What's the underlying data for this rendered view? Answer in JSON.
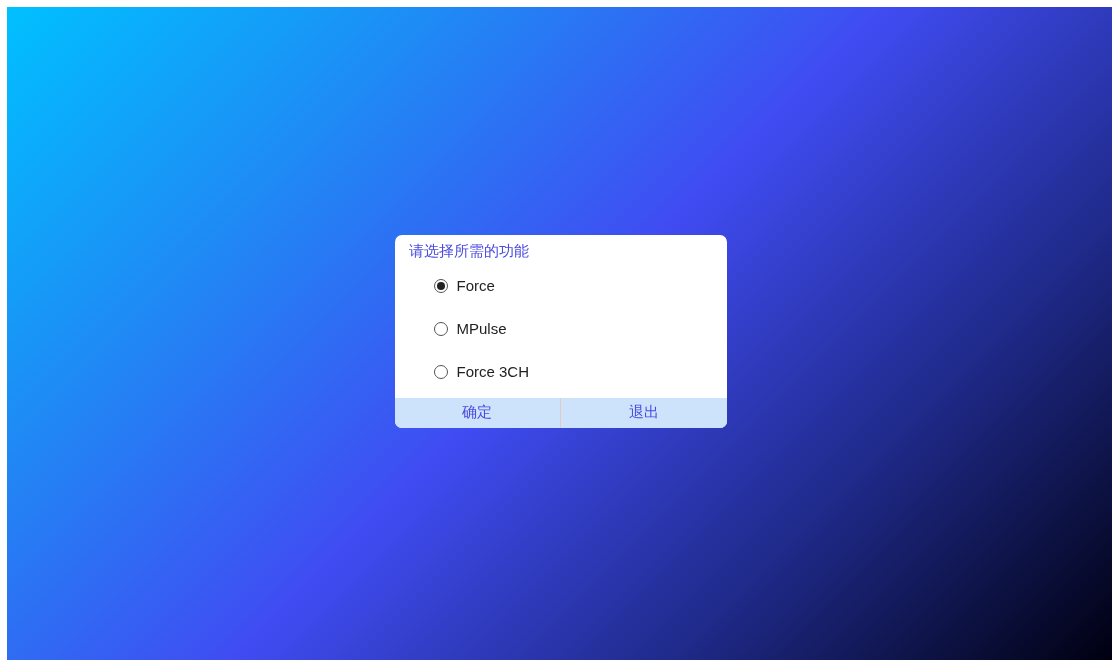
{
  "dialog": {
    "title": "请选择所需的功能",
    "options": [
      {
        "label": "Force",
        "selected": true
      },
      {
        "label": "MPulse",
        "selected": false
      },
      {
        "label": "Force 3CH",
        "selected": false
      }
    ],
    "buttons": [
      "确定",
      "退出"
    ]
  }
}
